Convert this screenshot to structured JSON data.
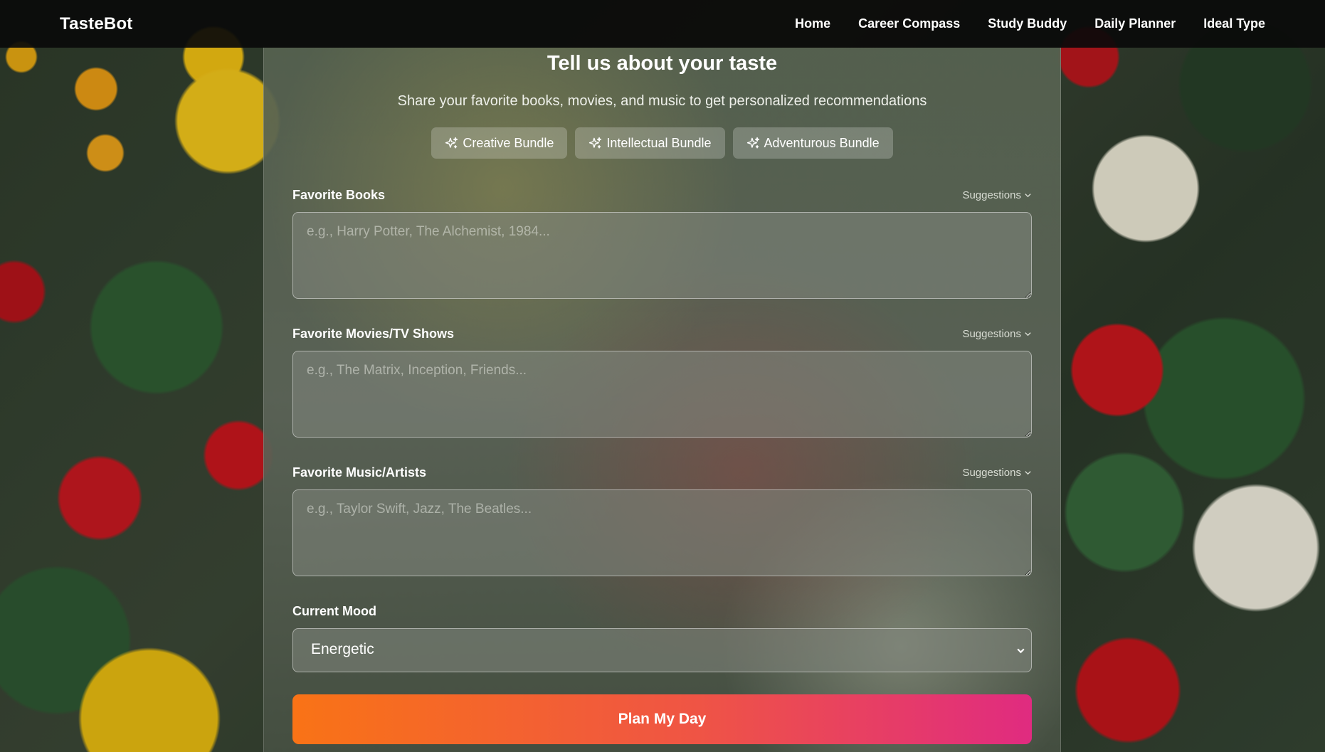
{
  "app": {
    "brand": "TasteBot"
  },
  "nav": {
    "links": [
      "Home",
      "Career Compass",
      "Study Buddy",
      "Daily Planner",
      "Ideal Type"
    ]
  },
  "main": {
    "title": "Tell us about your taste",
    "subtitle": "Share your favorite books, movies, and music to get personalized recommendations",
    "bundles": [
      {
        "label": "Creative Bundle",
        "icon": "sparkles-icon"
      },
      {
        "label": "Intellectual Bundle",
        "icon": "sparkles-icon"
      },
      {
        "label": "Adventurous Bundle",
        "icon": "sparkles-icon"
      }
    ],
    "fields": [
      {
        "label": "Favorite Books",
        "suggestions": "Suggestions",
        "value": "",
        "placeholder": "e.g., Harry Potter, The Alchemist, 1984..."
      },
      {
        "label": "Favorite Movies/TV Shows",
        "suggestions": "Suggestions",
        "value": "",
        "placeholder": "e.g., The Matrix, Inception, Friends..."
      },
      {
        "label": "Favorite Music/Artists",
        "suggestions": "Suggestions",
        "value": "",
        "placeholder": "e.g., Taylor Swift, Jazz, The Beatles..."
      }
    ],
    "mood": {
      "label": "Current Mood",
      "selected": "Energetic"
    },
    "submit_label": "Plan My Day"
  },
  "colors": {
    "navbar_bg": "#0a0a0a",
    "submit_gradient_start": "#f97316",
    "submit_gradient_end": "#e02b80"
  }
}
